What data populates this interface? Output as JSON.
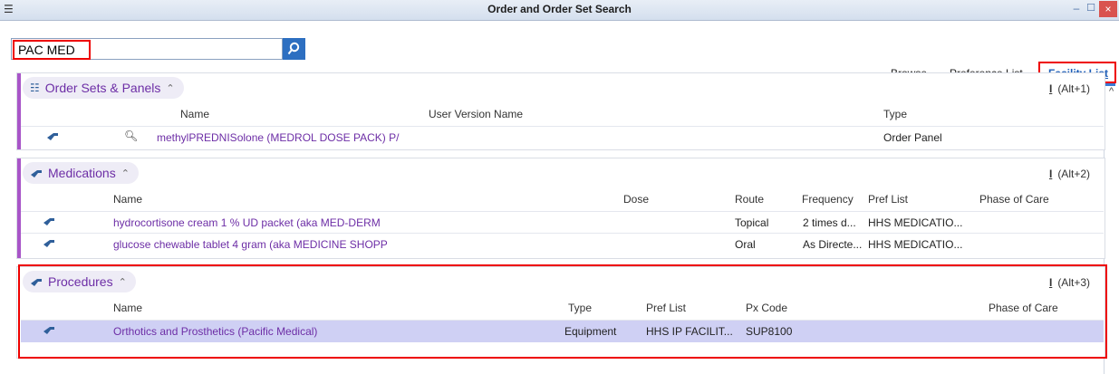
{
  "window": {
    "title": "Order and Order Set Search",
    "close_glyph": "×",
    "min_glyph": "–",
    "max_glyph": "☐"
  },
  "search": {
    "value": "PAC MED"
  },
  "tabs": [
    {
      "label": "Browse"
    },
    {
      "label": "Preference List"
    },
    {
      "label": "Facility List",
      "active": true
    }
  ],
  "sections": {
    "order_sets": {
      "title": "Order Sets & Panels",
      "shortcut": "(Alt+1)",
      "columns": {
        "name": "Name",
        "user_version": "User Version Name",
        "type": "Type"
      },
      "rows": [
        {
          "name": "methylPREDNISolone (MEDROL DOSE PACK) P/",
          "type": "Order Panel"
        }
      ]
    },
    "medications": {
      "title": "Medications",
      "shortcut": "(Alt+2)",
      "columns": {
        "name": "Name",
        "dose": "Dose",
        "route": "Route",
        "frequency": "Frequency",
        "pref_list": "Pref List",
        "phase": "Phase of Care"
      },
      "rows": [
        {
          "name": "hydrocortisone cream 1 % UD packet (aka MED-DERM",
          "route": "Topical",
          "frequency": "2 times d...",
          "pref_list": "HHS MEDICATIO..."
        },
        {
          "name": "glucose chewable tablet 4 gram (aka MEDICINE SHOPP",
          "route": "Oral",
          "frequency": "As Directe...",
          "pref_list": "HHS MEDICATIO..."
        }
      ]
    },
    "procedures": {
      "title": "Procedures",
      "shortcut": "(Alt+3)",
      "columns": {
        "name": "Name",
        "type": "Type",
        "pref_list": "Pref List",
        "px_code": "Px Code",
        "phase": "Phase of Care"
      },
      "rows": [
        {
          "name": "Orthotics and Prosthetics (Pacific Medical)",
          "type": "Equipment",
          "pref_list": "HHS IP FACILIT...",
          "px_code": "SUP8100"
        }
      ]
    }
  },
  "colors": {
    "accent": "#a855c8",
    "link": "#6d2ea6",
    "highlight": "#ff0000",
    "selected_row": "#cfd0f4"
  }
}
